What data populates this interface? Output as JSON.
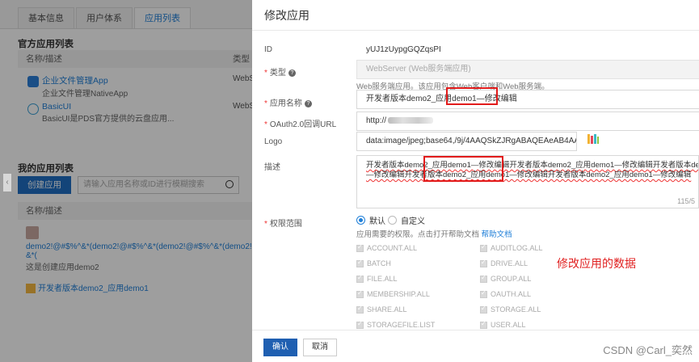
{
  "bg": {
    "tabs": [
      "基本信息",
      "用户体系",
      "应用列表"
    ],
    "official_title": "官方应用列表",
    "col_name": "名称/描述",
    "col_type": "类型",
    "apps": [
      {
        "name": "企业文件管理App",
        "desc": "企业文件管理NativeApp",
        "type": "WebS",
        "color": "#2b7fd9"
      },
      {
        "name": "BasicUI",
        "desc": "BasicUI是PDS官方提供的云盘应用...",
        "type": "WebS",
        "color": "#3aa0d6"
      }
    ],
    "my_title": "我的应用列表",
    "create_btn": "创建应用",
    "search_placeholder": "请输入应用名称或ID进行模糊搜索",
    "my_col_name": "名称/描述",
    "my_app1_name_l1": "demo2!@#$%^&*(demo2!@#$%^&*(demo2!@#$%^&*(demo2!@#$%^",
    "my_app1_name_l2": "&*(",
    "my_app1_desc": "这是创建应用demo2",
    "my_app2_name": "开发者版本demo2_应用demo1"
  },
  "drawer": {
    "title": "修改应用",
    "id_label": "ID",
    "id_value": "yUJ1zUypgGQZqsPI",
    "type_label": "类型",
    "type_value": "WebServer (Web服务端应用)",
    "type_hint": "Web服务端应用。该应用包含Web客户端和Web服务端。",
    "name_label": "应用名称",
    "name_value": "开发者版本demo2_应用demo1—修改编辑",
    "oauth_label": "OAuth2.0回调URL",
    "oauth_value": "http://",
    "logo_label": "Logo",
    "logo_value": "data:image/jpeg;base64,/9j/4AAQSkZJRgABAQEAeAB4AAD/2wBDAAI",
    "desc_label": "描述",
    "desc_line1": "开发者版本demo2_应用demo1—修改编辑开发者版本demo2_应用demo1—修改编辑开发者版本demo2_应用demo",
    "desc_line2": "—修改编辑开发者版本demo2_应用demo1—修改编辑开发者版本demo2_应用demo1—修改编辑",
    "desc_counter": "115/5",
    "scope_label": "权限范围",
    "scope_default": "默认",
    "scope_custom": "自定义",
    "scope_hint": "应用需要的权限。点击打开帮助文档",
    "scope_help": "帮助文档",
    "perms_left": [
      "ACCOUNT.ALL",
      "BATCH",
      "FILE.ALL",
      "MEMBERSHIP.ALL",
      "SHARE.ALL",
      "STORAGEFILE.LIST"
    ],
    "perms_right": [
      "AUDITLOG.ALL",
      "DRIVE.ALL",
      "GROUP.ALL",
      "OAUTH.ALL",
      "STORAGE.ALL",
      "USER.ALL"
    ],
    "note": "修改应用的数据",
    "confirm": "确认",
    "cancel": "取消"
  },
  "watermark": "CSDN @Carl_奕然"
}
